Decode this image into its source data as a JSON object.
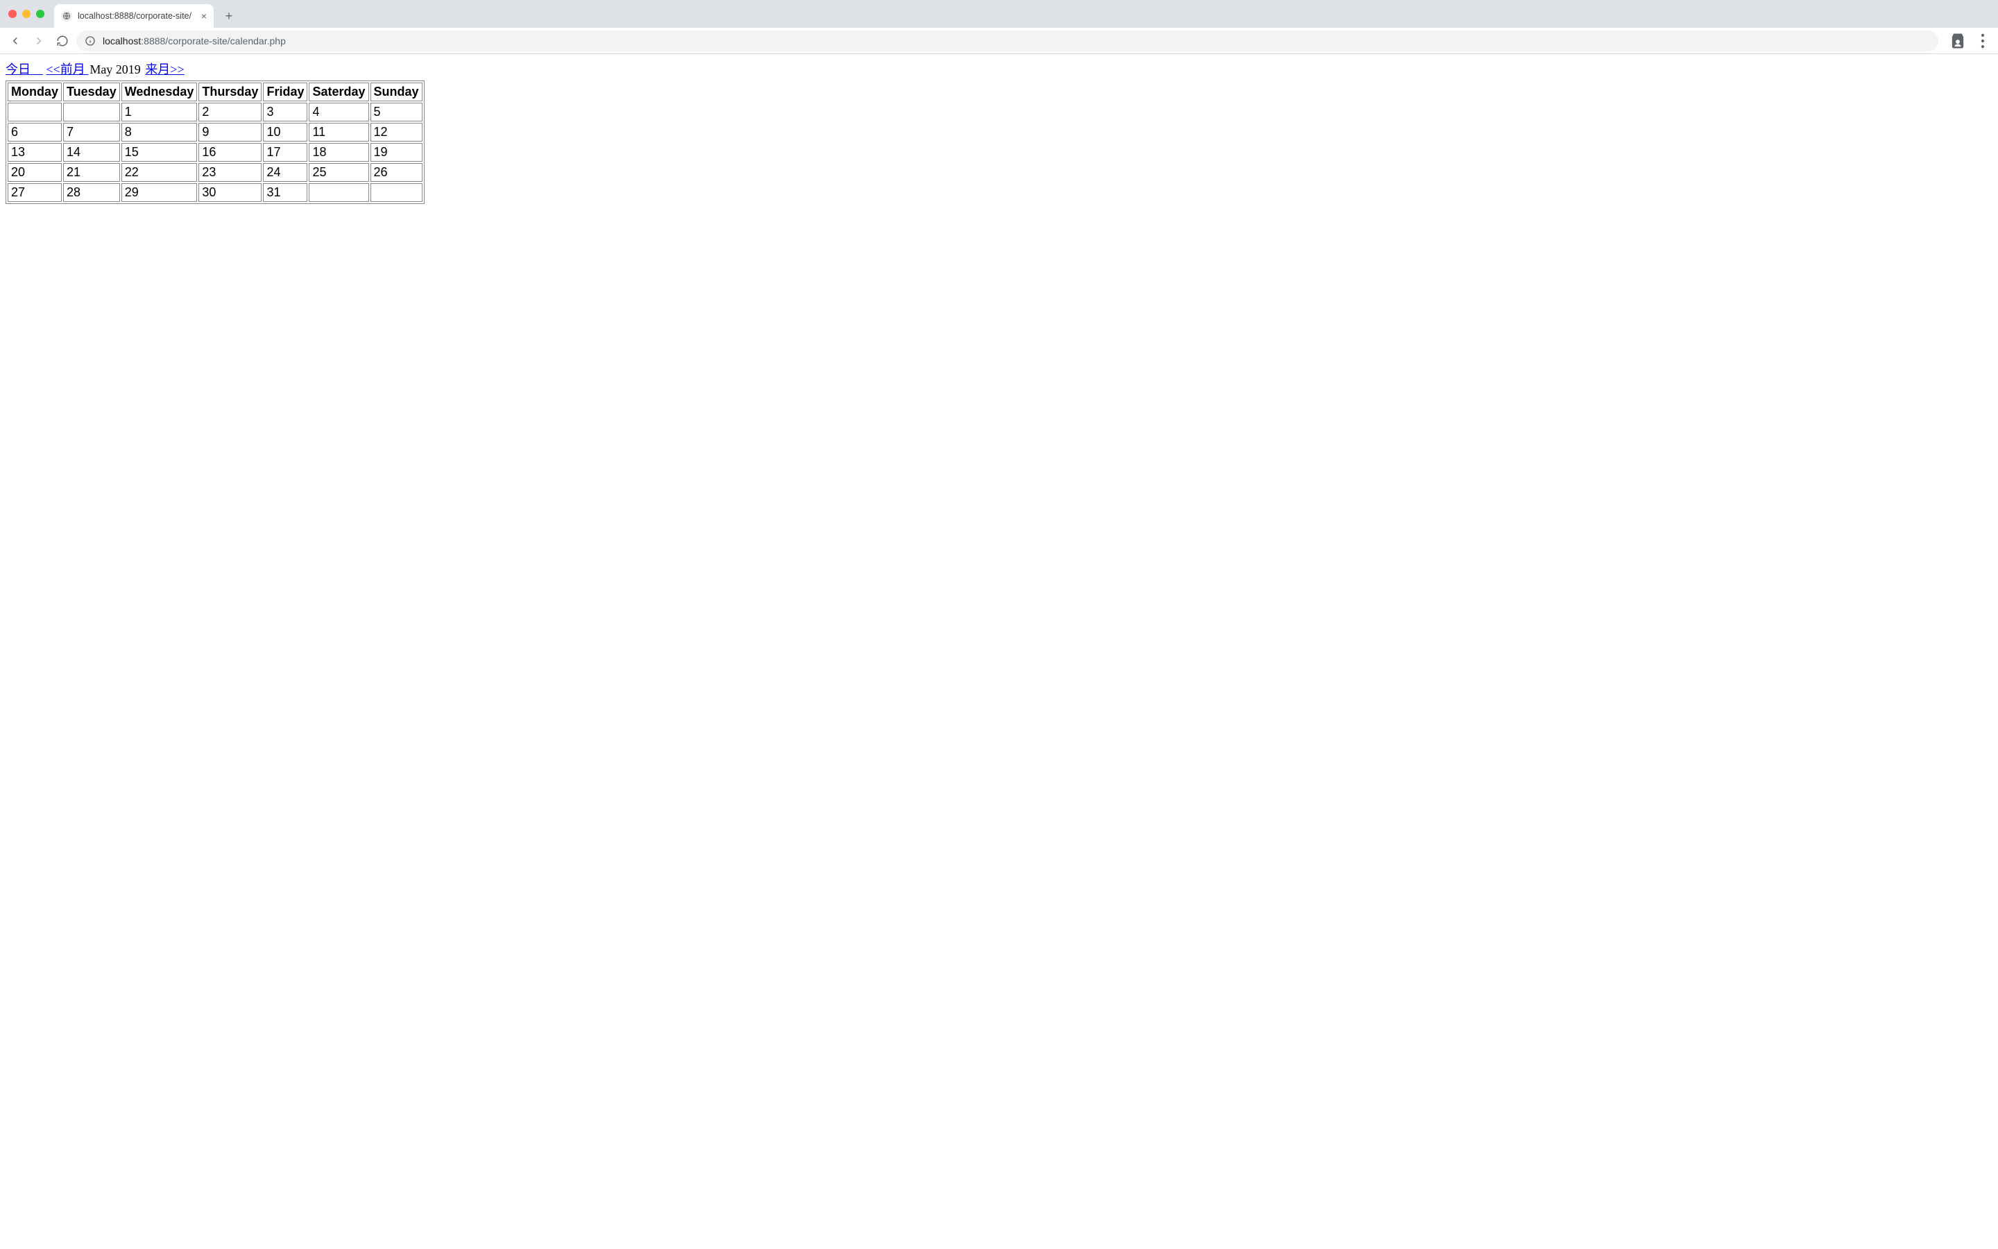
{
  "browser": {
    "tab_title": "localhost:8888/corporate-site/",
    "url_host": "localhost",
    "url_port_path": ":8888/corporate-site/calendar.php"
  },
  "nav": {
    "today": "今日　",
    "prev": "<<前月 ",
    "month_label": "May 2019",
    "next": " 来月>>"
  },
  "calendar": {
    "headers": [
      "Monday",
      "Tuesday",
      "Wednesday",
      "Thursday",
      "Friday",
      "Saterday",
      "Sunday"
    ],
    "rows": [
      [
        {
          "day": "",
          "cls": "empty"
        },
        {
          "day": "1",
          "cls": ""
        },
        {
          "day": "2",
          "cls": ""
        },
        {
          "day": "3",
          "cls": ""
        },
        {
          "day": "4",
          "cls": "sat"
        },
        {
          "day": "5",
          "cls": "sun"
        },
        null
      ],
      [
        {
          "day": "6",
          "cls": ""
        },
        {
          "day": "7",
          "cls": ""
        },
        {
          "day": "8",
          "cls": ""
        },
        {
          "day": "9",
          "cls": ""
        },
        {
          "day": "10",
          "cls": ""
        },
        {
          "day": "11",
          "cls": "sat"
        },
        {
          "day": "12",
          "cls": "sun"
        }
      ],
      [
        {
          "day": "13",
          "cls": ""
        },
        {
          "day": "14",
          "cls": ""
        },
        {
          "day": "15",
          "cls": ""
        },
        {
          "day": "16",
          "cls": ""
        },
        {
          "day": "17",
          "cls": ""
        },
        {
          "day": "18",
          "cls": "sat"
        },
        {
          "day": "19",
          "cls": "sun"
        }
      ],
      [
        {
          "day": "20",
          "cls": ""
        },
        {
          "day": "21",
          "cls": ""
        },
        {
          "day": "22",
          "cls": ""
        },
        {
          "day": "23",
          "cls": ""
        },
        {
          "day": "24",
          "cls": ""
        },
        {
          "day": "25",
          "cls": "sat"
        },
        {
          "day": "26",
          "cls": "sun"
        }
      ],
      [
        {
          "day": "27",
          "cls": ""
        },
        {
          "day": "28",
          "cls": ""
        },
        {
          "day": "29",
          "cls": ""
        },
        {
          "day": "30",
          "cls": "today"
        },
        {
          "day": "31",
          "cls": ""
        },
        {
          "day": "",
          "cls": "empty"
        },
        {
          "day": "",
          "cls": "empty"
        }
      ]
    ]
  }
}
